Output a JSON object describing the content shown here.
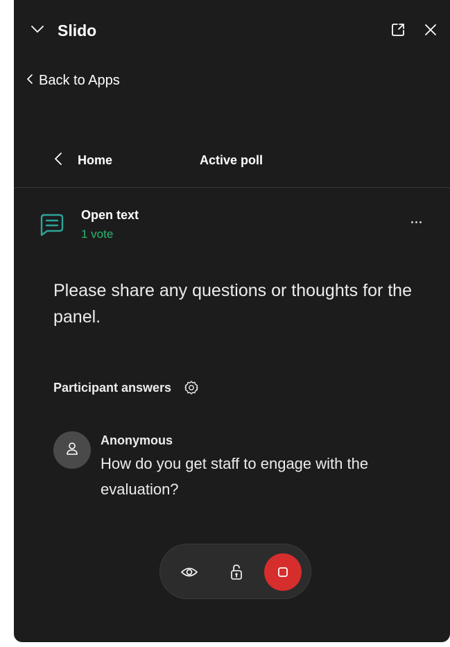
{
  "window": {
    "title": "Slido",
    "collapse_icon": "chevron-down-icon",
    "popout_icon": "popout-icon",
    "close_icon": "close-icon"
  },
  "back": {
    "label": "Back to Apps",
    "icon": "chevron-left-icon"
  },
  "nav": {
    "home_label": "Home",
    "active_label": "Active poll"
  },
  "poll": {
    "icon": "open-text-poll-icon",
    "type": "Open text",
    "votes": "1 vote",
    "question": "Please share any questions or thoughts for the panel.",
    "more_icon": "more-icon"
  },
  "answers": {
    "heading": "Participant answers",
    "settings_icon": "gear-icon",
    "items": [
      {
        "author": "Anonymous",
        "text": "How do you get staff to engage with the evaluation?",
        "avatar_icon": "person-icon"
      }
    ]
  },
  "controls": {
    "show_icon": "eye-icon",
    "lock_icon": "unlock-icon",
    "stop_icon": "stop-icon"
  },
  "colors": {
    "background": "#1c1c1c",
    "accent_green": "#2bb673",
    "teal_icon": "#2ba59b",
    "stop_red": "#d62d2d"
  }
}
